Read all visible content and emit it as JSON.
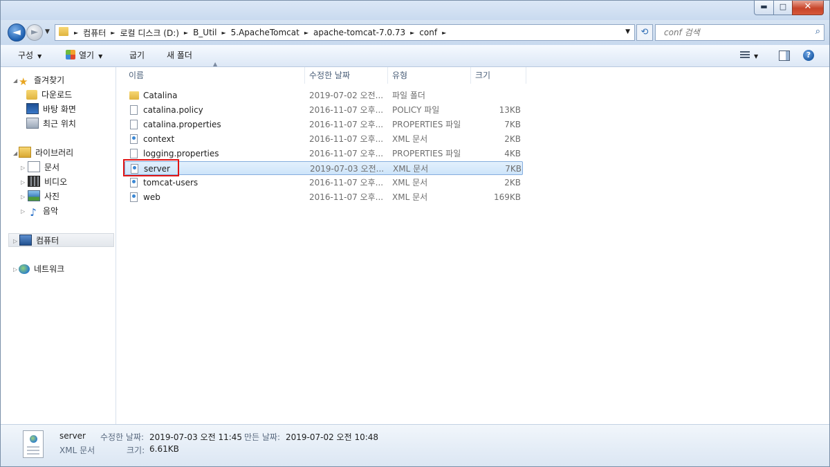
{
  "window": {
    "minimize": "▬",
    "maximize": "□",
    "close": "✕"
  },
  "address": {
    "back_glyph": "◄",
    "forward_glyph": "►",
    "crumbs": [
      "컴퓨터",
      "로컬 디스크 (D:)",
      "B_Util",
      "5.ApacheTomcat",
      "apache-tomcat-7.0.73",
      "conf"
    ],
    "refresh_glyph": "⟲"
  },
  "search": {
    "placeholder": "conf 검색"
  },
  "toolbar": {
    "organize": "구성",
    "open": "열기",
    "burn": "굽기",
    "new_folder": "새 폴더",
    "help": "?"
  },
  "nav": {
    "favorites": "즐겨찾기",
    "downloads": "다운로드",
    "desktop": "바탕 화면",
    "recent": "최근 위치",
    "libraries": "라이브러리",
    "documents": "문서",
    "videos": "비디오",
    "pictures": "사진",
    "music": "음악",
    "computer": "컴퓨터",
    "network": "네트워크"
  },
  "columns": {
    "name": "이름",
    "date": "수정한 날짜",
    "type": "유형",
    "size": "크기"
  },
  "files": [
    {
      "name": "Catalina",
      "date": "2019-07-02 오전...",
      "type": "파일 폴더",
      "size": "",
      "kind": "folder"
    },
    {
      "name": "catalina.policy",
      "date": "2016-11-07 오후...",
      "type": "POLICY 파일",
      "size": "13KB",
      "kind": "file"
    },
    {
      "name": "catalina.properties",
      "date": "2016-11-07 오후...",
      "type": "PROPERTIES 파일",
      "size": "7KB",
      "kind": "file"
    },
    {
      "name": "context",
      "date": "2016-11-07 오후...",
      "type": "XML 문서",
      "size": "2KB",
      "kind": "xml"
    },
    {
      "name": "logging.properties",
      "date": "2016-11-07 오후...",
      "type": "PROPERTIES 파일",
      "size": "4KB",
      "kind": "file"
    },
    {
      "name": "server",
      "date": "2019-07-03 오전...",
      "type": "XML 문서",
      "size": "7KB",
      "kind": "xml"
    },
    {
      "name": "tomcat-users",
      "date": "2016-11-07 오후...",
      "type": "XML 문서",
      "size": "2KB",
      "kind": "xml"
    },
    {
      "name": "web",
      "date": "2016-11-07 오후...",
      "type": "XML 문서",
      "size": "169KB",
      "kind": "xml"
    }
  ],
  "selected_index": 5,
  "details": {
    "name": "server",
    "type": "XML 문서",
    "modified_label": "수정한 날짜:",
    "modified_value": "2019-07-03 오전 11:45",
    "created_label": "만든 날짜:",
    "created_value": "2019-07-02 오전 10:48",
    "size_label": "크기:",
    "size_value": "6.61KB"
  },
  "colors": {
    "highlight_box": "#e01414",
    "selection": "#cde4fa"
  }
}
